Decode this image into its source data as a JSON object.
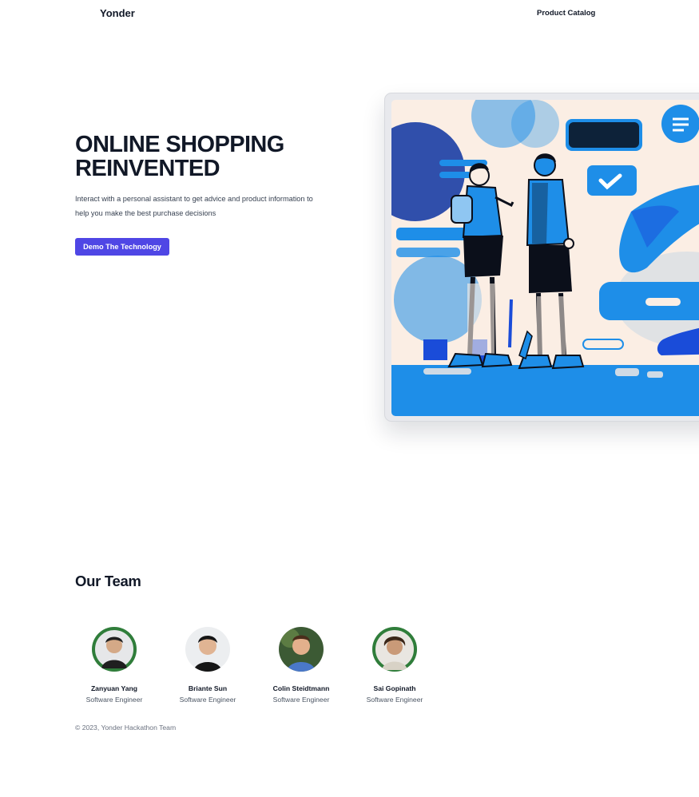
{
  "nav": {
    "brand": "Yonder",
    "links": [
      {
        "label": "Product Catalog"
      }
    ]
  },
  "hero": {
    "title_line1": "ONLINE SHOPPING",
    "title_line2": "REINVENTED",
    "description": "Interact with a personal assistant to get advice and product information to help you make the best purchase decisions",
    "cta_label": "Demo The Technology",
    "accent_color": "#4f46e5",
    "illustration_palette": [
      "#1e8ee8",
      "#1a4cd9",
      "#0b0f1a",
      "#fbeee4"
    ]
  },
  "team": {
    "title": "Our Team",
    "members": [
      {
        "name": "Zanyuan Yang",
        "role": "Software Engineer"
      },
      {
        "name": "Briante Sun",
        "role": "Software Engineer"
      },
      {
        "name": "Colin Steidtmann",
        "role": "Software Engineer"
      },
      {
        "name": "Sai Gopinath",
        "role": "Software Engineer"
      }
    ]
  },
  "footer": {
    "copyright": "© 2023, Yonder Hackathon Team"
  }
}
